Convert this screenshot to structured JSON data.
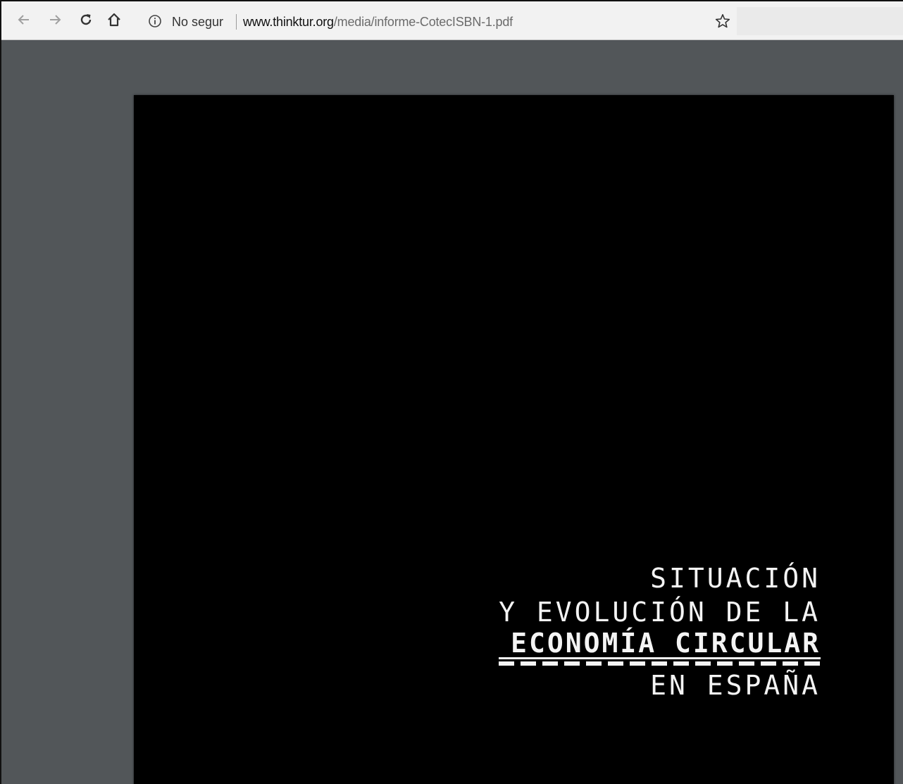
{
  "browser": {
    "security_label": "No segur",
    "url_host": "www.thinktur.org",
    "url_path": "/media/informe-CotecISBN-1.pdf"
  },
  "pdf": {
    "cover": {
      "line1": "SITUACIÓN",
      "line2": "Y EVOLUCIÓN DE LA",
      "line3": "ECONOMÍA CIRCULAR",
      "line4": "EN ESPAÑA"
    }
  },
  "colors": {
    "viewer_background": "#525659",
    "page_background": "#000000",
    "cover_text": "#f4f4f4"
  },
  "icons": {
    "back": "back-arrow-icon",
    "forward": "forward-arrow-icon",
    "reload": "reload-icon",
    "home": "home-icon",
    "info": "info-icon",
    "bookmark": "star-icon"
  }
}
